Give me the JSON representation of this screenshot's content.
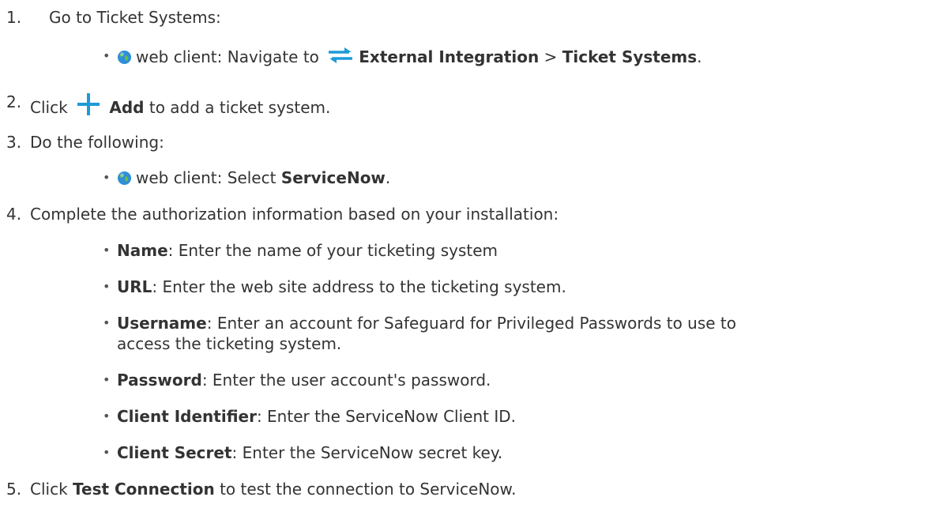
{
  "steps": [
    {
      "num": "1.",
      "text": "Go to Ticket Systems:"
    },
    {
      "num": "2.",
      "pre": "Click",
      "bold": "Add",
      "post": "to add a ticket system."
    },
    {
      "num": "3.",
      "text": "Do the following:"
    },
    {
      "num": "4.",
      "text": "Complete the authorization information based on your installation:"
    },
    {
      "num": "5.",
      "pre": "Click",
      "bold": "Test Connection",
      "post": "to test the connection to ServiceNow."
    }
  ],
  "step1_sub": {
    "client": "web client",
    "prefix": ": Navigate to",
    "path1": "External Integration",
    "sep": ">",
    "path2": "Ticket Systems",
    "end": "."
  },
  "step3_sub": {
    "client": "web client",
    "prefix": ": Select",
    "bold": "ServiceNow",
    "end": "."
  },
  "fields": [
    {
      "label": "Name",
      "desc": ": Enter the name of your ticketing system"
    },
    {
      "label": "URL",
      "desc": ": Enter the web site address to the ticketing system."
    },
    {
      "label": "Username",
      "desc": ": Enter an account for Safeguard for Privileged Passwords to use to",
      "desc2": "access the ticketing system."
    },
    {
      "label": "Password",
      "desc": ": Enter the user account's password."
    },
    {
      "label": "Client Identifier",
      "desc": ": Enter the ServiceNow Client ID."
    },
    {
      "label": "Client Secret",
      "desc": ": Enter the ServiceNow secret key."
    }
  ],
  "bullet_char": "•",
  "colors": {
    "text": "#333333",
    "icon_blue": "#1e9bd7",
    "globe_blue": "#2f8fd8",
    "globe_green": "#6cbf3a"
  },
  "icons": {
    "globe": "web-client-globe-icon",
    "integration": "exchange-arrows-icon",
    "add": "plus-icon"
  }
}
